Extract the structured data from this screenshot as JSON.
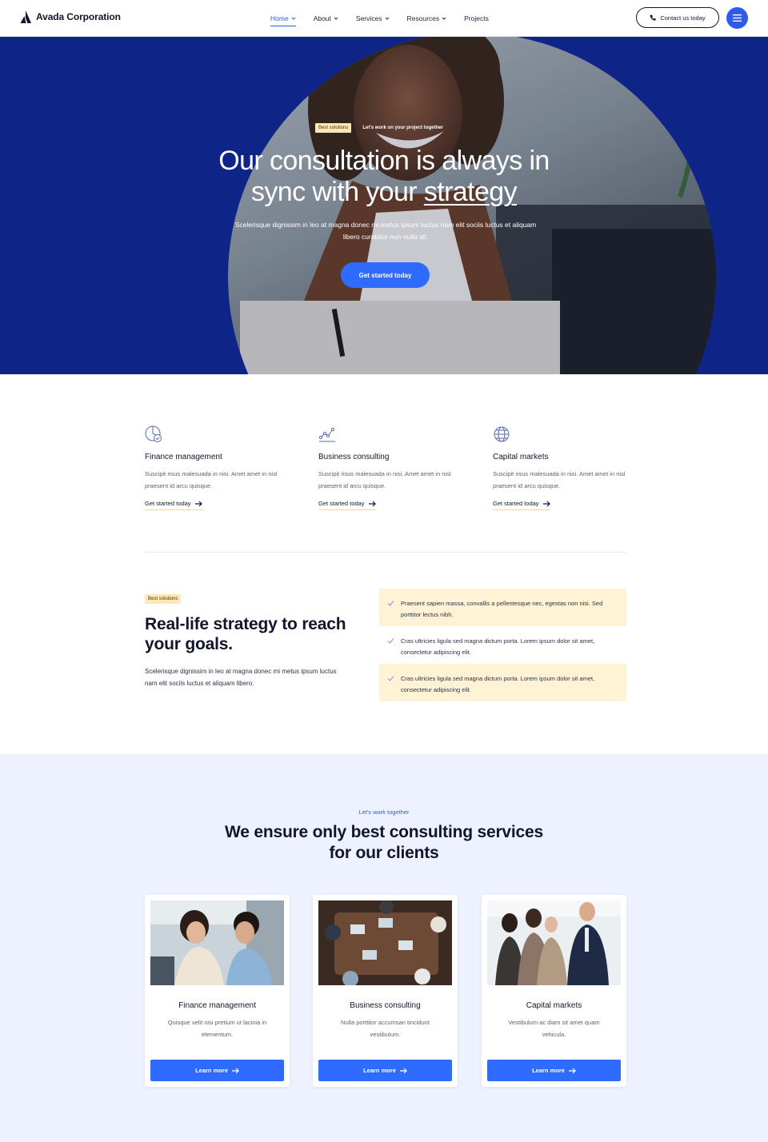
{
  "header": {
    "logo_text": "Avada Corporation",
    "nav": [
      {
        "label": "Home",
        "has_caret": true,
        "active": true
      },
      {
        "label": "About",
        "has_caret": true
      },
      {
        "label": "Services",
        "has_caret": true
      },
      {
        "label": "Resources",
        "has_caret": true
      },
      {
        "label": "Projects",
        "has_caret": false
      }
    ],
    "contact_label": "Contact us today",
    "accent": "#2f5bea"
  },
  "hero": {
    "tag": "Best solutions",
    "tag_text": "Let's work on your project together",
    "title_line1": "Our consultation is always in",
    "title_line2_plain": "sync with your ",
    "title_line2_underlined": "strategy",
    "subtitle": "Scelerisque dignissim in leo at magna donec mi metus ipsum luctus nam elit sociis luctus et aliquam libero curabitur non nulla sit.",
    "cta": "Get started today",
    "bg_color": "#0f2487"
  },
  "features": [
    {
      "icon": "chart-pie-check-icon",
      "title": "Finance management",
      "desc": "Suscipit risus malesuada in nisi. Amet amet in nisl praesent id arcu quisque.",
      "link": "Get started today"
    },
    {
      "icon": "line-graph-icon",
      "title": "Business consulting",
      "desc": "Suscipit risus malesuada in nisi. Amet amet in nisl praesent id arcu quisque.",
      "link": "Get started today"
    },
    {
      "icon": "globe-icon",
      "title": "Capital markets",
      "desc": "Suscipit risus malesuada in nisi. Amet amet in nisl praesent id arcu quisque.",
      "link": "Get started today"
    }
  ],
  "strategy": {
    "tag": "Best solutions",
    "title": "Real-life strategy to reach your goals.",
    "desc": "Scelerisque dignissim in leo at magna donec mi metus ipsum luctus nam elit sociis luctus et aliquam libero.",
    "checklist": [
      {
        "text": "Praesent sapien massa, convallis a pellentesque nec, egestas non nisi. Sed porttitor lectus nibh.",
        "shaded": true
      },
      {
        "text": "Cras ultricies ligula sed magna dictum porta. Lorem ipsum dolor sit amet, consectetur adipiscing elit.",
        "shaded": false
      },
      {
        "text": "Cras ultricies ligula sed magna dictum porta. Lorem ipsum dolor sit amet, consectetur adipiscing elit.",
        "shaded": true
      }
    ]
  },
  "services": {
    "eyebrow": "Let's work together",
    "title": "We ensure only best consulting services for our clients",
    "cards": [
      {
        "title": "Finance management",
        "desc": "Quisque velit nisi pretium ut lacinia in elementum.",
        "button": "Learn more"
      },
      {
        "title": "Business consulting",
        "desc": "Nulla porttitor accumsan tincidunt vestibulum.",
        "button": "Learn more"
      },
      {
        "title": "Capital markets",
        "desc": "Vestibulum ac diam sit amet quam vehicula.",
        "button": "Learn more"
      }
    ]
  }
}
